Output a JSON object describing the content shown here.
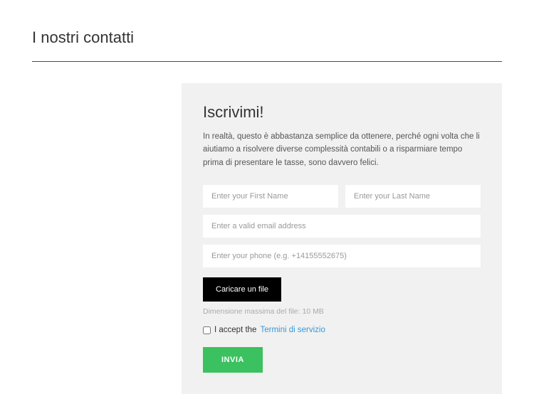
{
  "page": {
    "title": "I nostri contatti"
  },
  "form": {
    "title": "Iscrivimi!",
    "description": "In realtà, questo è abbastanza semplice da ottenere, perché ogni volta che li aiutiamo a risolvere diverse complessità contabili o a risparmiare tempo prima di presentare le tasse, sono davvero felici.",
    "firstName": {
      "value": "",
      "placeholder": "Enter your First Name"
    },
    "lastName": {
      "value": "",
      "placeholder": "Enter your Last Name"
    },
    "email": {
      "value": "",
      "placeholder": "Enter a valid email address"
    },
    "phone": {
      "value": "",
      "placeholder": "Enter your phone (e.g. +14155552675)"
    },
    "fileButton": "Caricare un file",
    "fileHint": "Dimensione massima del file: 10 MB",
    "acceptLabel": "I accept the ",
    "termsLink": "Termini di servizio",
    "submitLabel": "INVIA"
  }
}
